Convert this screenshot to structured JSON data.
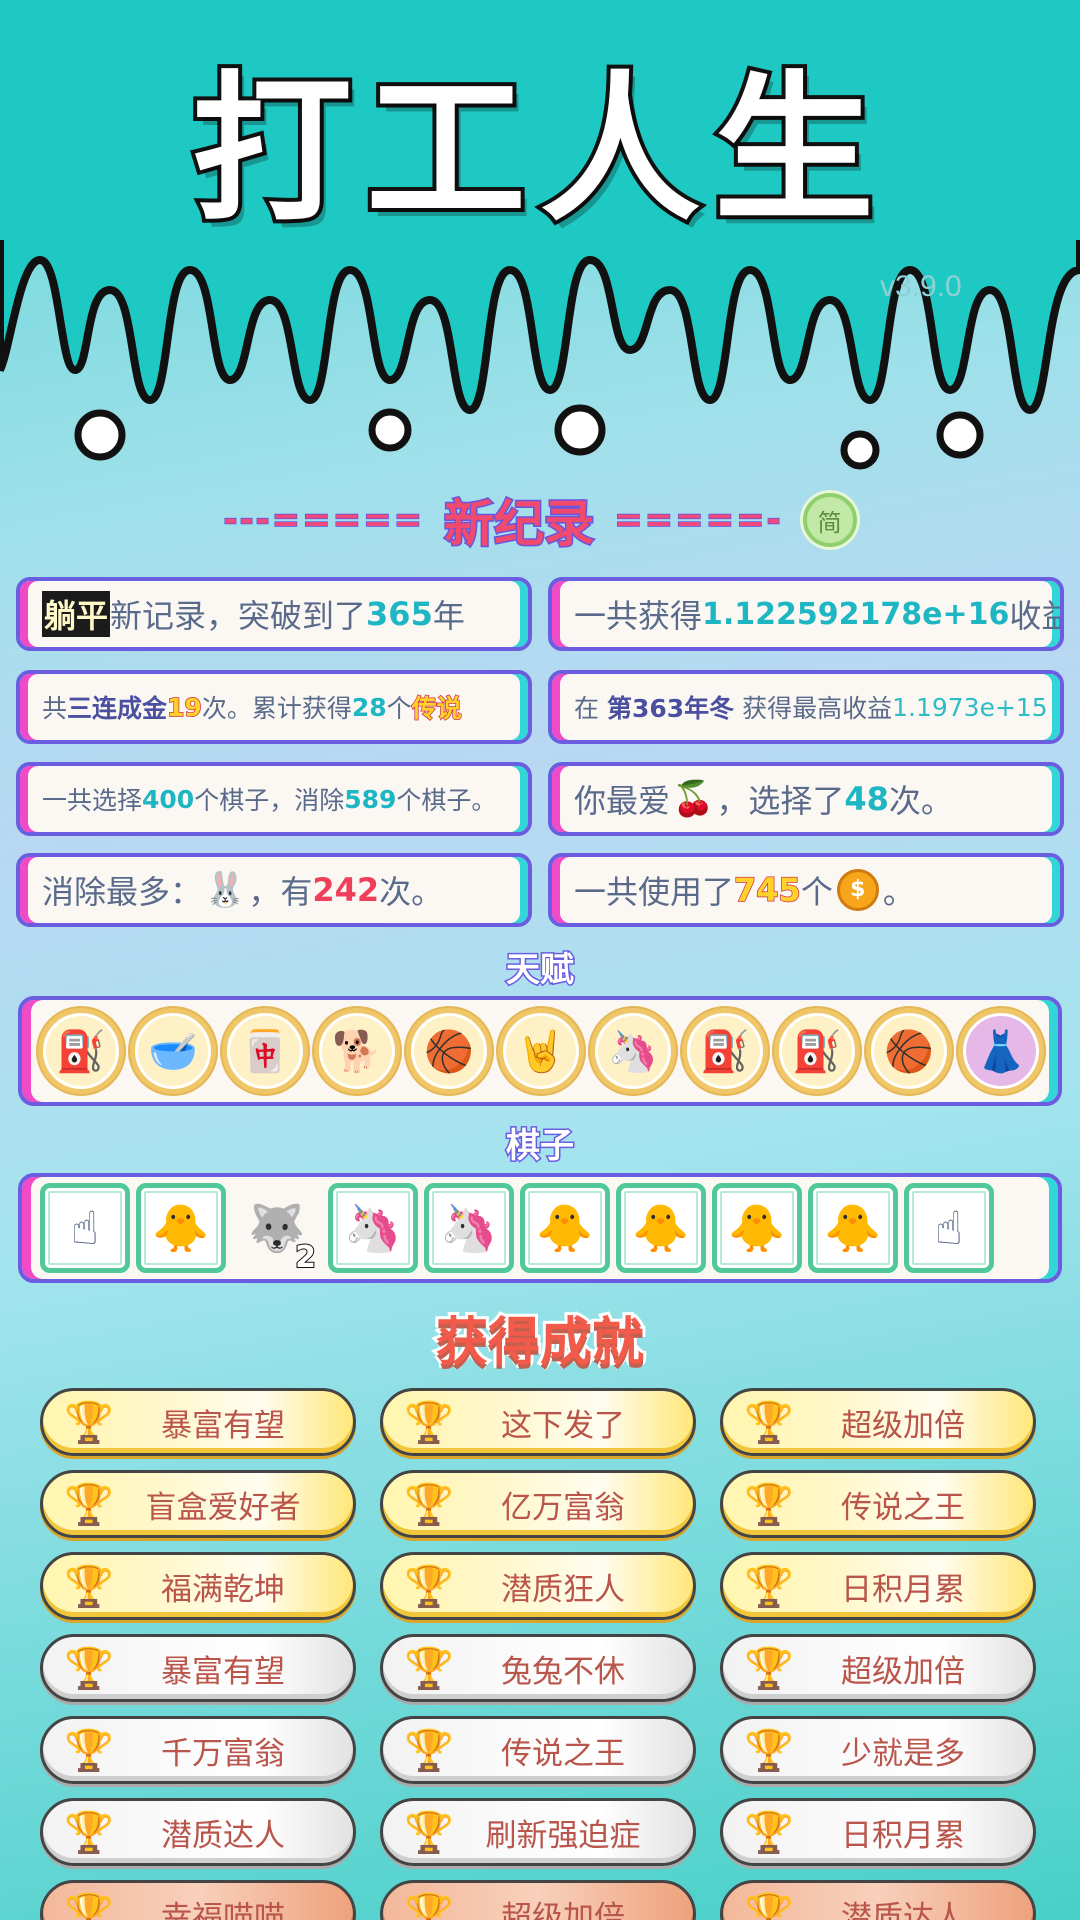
{
  "app": {
    "title": "打工人生",
    "version": "v3.9.0"
  },
  "record_header": {
    "dashes_left": "---=====",
    "title": "新纪录",
    "dashes_right": "=====-",
    "mode_badge": "简"
  },
  "stats": {
    "lie_flat_tag": "躺平",
    "r1_left_pre": "新记录，突破到了",
    "r1_left_num": "365",
    "r1_left_post": "年",
    "r1_right_pre": "一共获得",
    "r1_right_num": "1.122592178e+16",
    "r1_right_post": "收益",
    "r2_left_a": "共",
    "r2_left_b": "三连成金",
    "r2_left_c": "19",
    "r2_left_d": "次。累计获得",
    "r2_left_e": "28",
    "r2_left_f": "个",
    "r2_left_g": "传说",
    "r2_right_a": "在 ",
    "r2_right_b": "第363年冬",
    "r2_right_c": " 获得最高收益",
    "r2_right_d": "1.1973e+15",
    "r3_left_a": "一共选择",
    "r3_left_b": "400",
    "r3_left_c": "个棋子，消除",
    "r3_left_d": "589",
    "r3_left_e": "个棋子。",
    "r3_right_a": "你最爱",
    "r3_right_icon": "fruit-icon",
    "r3_right_b": "，选择了",
    "r3_right_c": "48",
    "r3_right_d": "次。",
    "r4_left_a": "消除最多：",
    "r4_left_icon": "rabbit-icon",
    "r4_left_b": "，有",
    "r4_left_c": "242",
    "r4_left_d": "次。",
    "r4_right_a": "一共使用了",
    "r4_right_b": "745",
    "r4_right_c": "个",
    "r4_right_coin": "$",
    "r4_right_d": "。"
  },
  "talents_title": "天赋",
  "talents": [
    "pump-icon",
    "dog-bowl-icon",
    "wang-tiles-icon",
    "cool-dog-icon",
    "basketballs-icon",
    "rock-hand-icon",
    "unicorn-icon",
    "pump-icon",
    "pump-icon",
    "basketballs-icon",
    "skirt-icon"
  ],
  "pieces_title": "棋子",
  "pieces": [
    {
      "icon": "pointer-hand-icon",
      "badge": ""
    },
    {
      "icon": "old-man-chick-icon",
      "badge": ""
    },
    {
      "icon": "husky-dog-icon",
      "badge": "2"
    },
    {
      "icon": "unicorn-icon",
      "badge": ""
    },
    {
      "icon": "unicorn-icon",
      "badge": ""
    },
    {
      "icon": "old-man-chick-icon",
      "badge": ""
    },
    {
      "icon": "old-man-chick-icon",
      "badge": ""
    },
    {
      "icon": "old-man-chick-icon",
      "badge": ""
    },
    {
      "icon": "old-man-chick-icon",
      "badge": ""
    },
    {
      "icon": "pointer-hand-icon",
      "badge": ""
    }
  ],
  "achievements_title": "获得成就",
  "achievements": [
    {
      "label": "暴富有望",
      "tier": "gold"
    },
    {
      "label": "这下发了",
      "tier": "gold"
    },
    {
      "label": "超级加倍",
      "tier": "gold"
    },
    {
      "label": "盲盒爱好者",
      "tier": "gold"
    },
    {
      "label": "亿万富翁",
      "tier": "gold"
    },
    {
      "label": "传说之王",
      "tier": "gold"
    },
    {
      "label": "福满乾坤",
      "tier": "gold"
    },
    {
      "label": "潜质狂人",
      "tier": "gold"
    },
    {
      "label": "日积月累",
      "tier": "gold"
    },
    {
      "label": "暴富有望",
      "tier": "silver"
    },
    {
      "label": "兔兔不休",
      "tier": "silver"
    },
    {
      "label": "超级加倍",
      "tier": "silver"
    },
    {
      "label": "千万富翁",
      "tier": "silver"
    },
    {
      "label": "传说之王",
      "tier": "silver"
    },
    {
      "label": "少就是多",
      "tier": "silver"
    },
    {
      "label": "潜质达人",
      "tier": "silver"
    },
    {
      "label": "刷新强迫症",
      "tier": "silver"
    },
    {
      "label": "日积月累",
      "tier": "silver"
    },
    {
      "label": "幸福喵喵",
      "tier": "bronze"
    },
    {
      "label": "超级加倍",
      "tier": "bronze"
    },
    {
      "label": "潜质达人",
      "tier": "bronze"
    }
  ]
}
